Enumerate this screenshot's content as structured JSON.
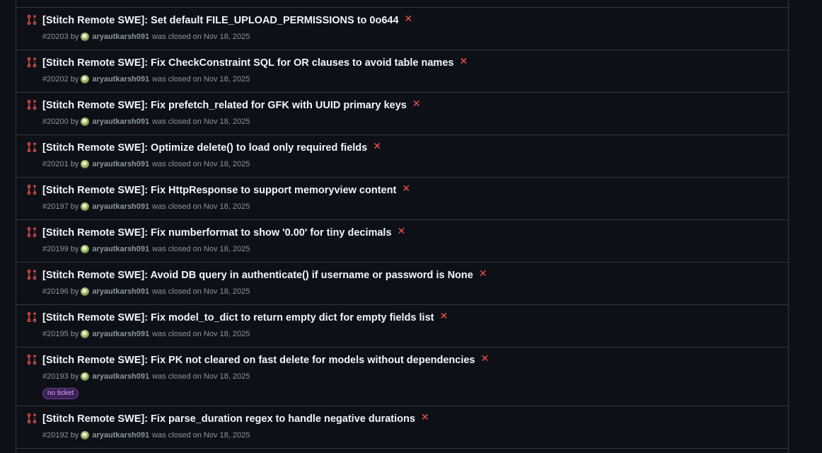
{
  "pull_requests": [
    {
      "title": "[Stitch Remote SWE]: Set default FILE_UPLOAD_PERMISSIONS to 0o644",
      "number": "#20203",
      "by": "by",
      "author": "aryautkarsh091",
      "status": "was closed on Nov 18, 2025"
    },
    {
      "title": "[Stitch Remote SWE]: Fix CheckConstraint SQL for OR clauses to avoid table names",
      "number": "#20202",
      "by": "by",
      "author": "aryautkarsh091",
      "status": "was closed on Nov 18, 2025"
    },
    {
      "title": "[Stitch Remote SWE]: Fix prefetch_related for GFK with UUID primary keys",
      "number": "#20200",
      "by": "by",
      "author": "aryautkarsh091",
      "status": "was closed on Nov 18, 2025"
    },
    {
      "title": "[Stitch Remote SWE]: Optimize delete() to load only required fields",
      "number": "#20201",
      "by": "by",
      "author": "aryautkarsh091",
      "status": "was closed on Nov 18, 2025"
    },
    {
      "title": "[Stitch Remote SWE]: Fix HttpResponse to support memoryview content",
      "number": "#20197",
      "by": "by",
      "author": "aryautkarsh091",
      "status": "was closed on Nov 18, 2025"
    },
    {
      "title": "[Stitch Remote SWE]: Fix numberformat to show '0.00' for tiny decimals",
      "number": "#20199",
      "by": "by",
      "author": "aryautkarsh091",
      "status": "was closed on Nov 18, 2025"
    },
    {
      "title": "[Stitch Remote SWE]: Avoid DB query in authenticate() if username or password is None",
      "number": "#20196",
      "by": "by",
      "author": "aryautkarsh091",
      "status": "was closed on Nov 18, 2025"
    },
    {
      "title": "[Stitch Remote SWE]: Fix model_to_dict to return empty dict for empty fields list",
      "number": "#20195",
      "by": "by",
      "author": "aryautkarsh091",
      "status": "was closed on Nov 18, 2025"
    },
    {
      "title": "[Stitch Remote SWE]: Fix PK not cleared on fast delete for models without dependencies",
      "number": "#20193",
      "by": "by",
      "author": "aryautkarsh091",
      "status": "was closed on Nov 18, 2025",
      "label": "no ticket"
    },
    {
      "title": "[Stitch Remote SWE]: Fix parse_duration regex to handle negative durations",
      "number": "#20192",
      "by": "by",
      "author": "aryautkarsh091",
      "status": "was closed on Nov 18, 2025"
    }
  ],
  "colors": {
    "closed_icon": "#f85149",
    "label_text": "#d2a8ff",
    "label_bg": "#3b2152"
  },
  "icons": {
    "pr_state": "git-pull-request-closed-icon",
    "status": "x-icon"
  }
}
